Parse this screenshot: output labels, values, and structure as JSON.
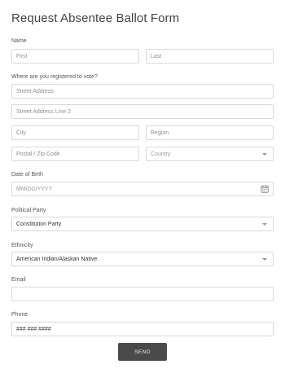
{
  "form": {
    "title": "Request Absentee Ballot Form",
    "name": {
      "label": "Name",
      "first_placeholder": "First",
      "last_placeholder": "Last"
    },
    "address": {
      "label": "Where are you registered to vote?",
      "street_placeholder": "Street Address",
      "street2_placeholder": "Street Address Line 2",
      "city_placeholder": "City",
      "region_placeholder": "Region",
      "postal_placeholder": "Postal / Zip Code",
      "country_placeholder": "Country"
    },
    "dob": {
      "label": "Date of Birth",
      "placeholder": "MM/DD/YYYY",
      "icon": "calendar-icon"
    },
    "party": {
      "label": "Political Party",
      "selected": "Constitution Party"
    },
    "ethnicity": {
      "label": "Ethnicity",
      "selected": "American Indian/Alaskan Native"
    },
    "email": {
      "label": "Email",
      "value": ""
    },
    "phone": {
      "label": "Phone",
      "placeholder": "### ### ####"
    },
    "submit_label": "SEND"
  }
}
